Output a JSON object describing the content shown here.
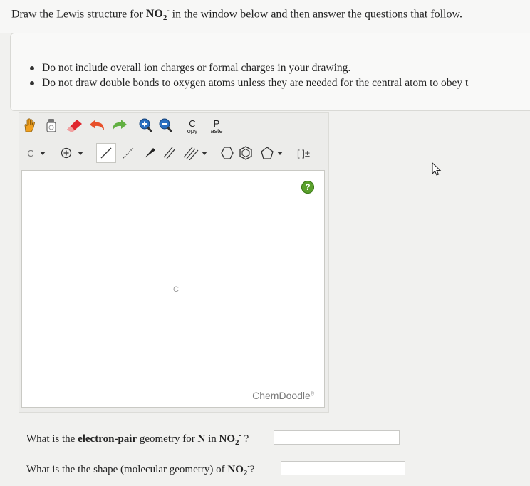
{
  "question": {
    "prefix": "Draw the Lewis structure for ",
    "formula_main": "NO",
    "formula_sub": "2",
    "formula_sup": "-",
    "suffix": " in the window below and then answer the questions that follow."
  },
  "instructions": [
    "Do not include overall ion charges or formal charges in your drawing.",
    "Do not draw double bonds to oxygen atoms unless they are needed for the central atom to obey t"
  ],
  "toolbar": {
    "copy_top": "C",
    "copy_bottom": "opy",
    "paste_top": "P",
    "paste_bottom": "aste",
    "atom_label": "C",
    "bracket_label": "[ ]±"
  },
  "canvas": {
    "atom_label": "C",
    "help_label": "?",
    "watermark": "ChemDoodle",
    "watermark_mark": "®"
  },
  "q1": {
    "prefix": "What is the ",
    "bold": "electron-pair",
    "middle": " geometry for ",
    "atom": "N",
    "mid2": " in ",
    "formula_main": "NO",
    "formula_sub": "2",
    "formula_sup": "-",
    "suffix": " ?",
    "value": ""
  },
  "q2": {
    "prefix": "What is the the shape (molecular geometry) of ",
    "formula_main": "NO",
    "formula_sub": "2",
    "formula_sup": "-",
    "suffix": "?",
    "value": ""
  },
  "colors": {
    "hand": "#f0a020",
    "eraser": "#e0262e",
    "undo": "#e8502a",
    "redo": "#62b042",
    "zoom": "#2a6fc0",
    "help": "#5aa02c"
  }
}
